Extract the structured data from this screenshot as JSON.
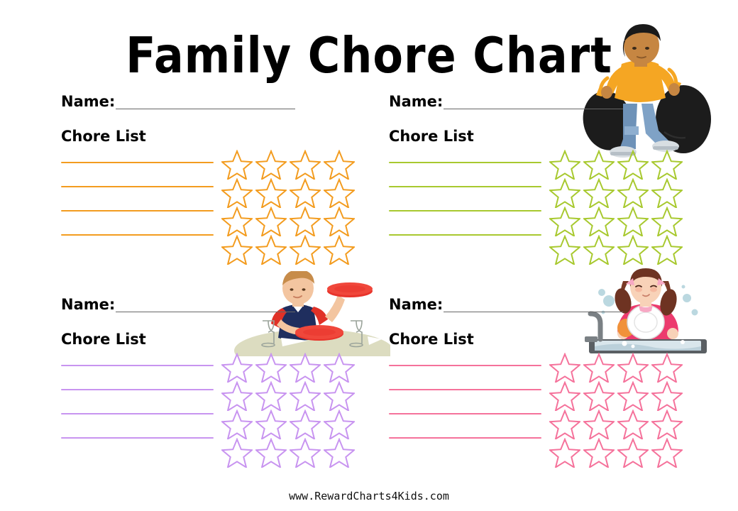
{
  "title": "Family Chore Chart",
  "footer": "www.RewardCharts4Kids.com",
  "labels": {
    "name": "Name:",
    "chore_list": "Chore List"
  },
  "colors": {
    "orange": "#F39C1F",
    "green": "#A8C92F",
    "purple": "#C894F0",
    "pink": "#F5729B",
    "name_rule": "#666666",
    "text": "#000000",
    "background": "#FFFFFF"
  },
  "quadrants": [
    {
      "id": "top-left",
      "name_label": "Name:",
      "name_value": "",
      "chore_list_label": "Chore List",
      "accent": "#F39C1F",
      "line_count": 4,
      "star_rows": 4,
      "star_cols": 4,
      "star_total": 16,
      "chores": [
        "",
        "",
        "",
        ""
      ]
    },
    {
      "id": "top-right",
      "name_label": "Name:",
      "name_value": "",
      "chore_list_label": "Chore List",
      "accent": "#A8C92F",
      "line_count": 4,
      "star_rows": 4,
      "star_cols": 4,
      "star_total": 16,
      "chores": [
        "",
        "",
        "",
        ""
      ]
    },
    {
      "id": "bottom-left",
      "name_label": "Name:",
      "name_value": "",
      "chore_list_label": "Chore List",
      "accent": "#C894F0",
      "line_count": 4,
      "star_rows": 4,
      "star_cols": 4,
      "star_total": 16,
      "chores": [
        "",
        "",
        "",
        ""
      ]
    },
    {
      "id": "bottom-right",
      "name_label": "Name:",
      "name_value": "",
      "chore_list_label": "Chore List",
      "accent": "#F5729B",
      "line_count": 4,
      "star_rows": 4,
      "star_cols": 4,
      "star_total": 16,
      "chores": [
        "",
        "",
        "",
        ""
      ]
    }
  ],
  "illustrations": [
    {
      "id": "boy-taking-out-trash",
      "description": "Boy in orange t-shirt and blue jeans carrying two black garbage bags",
      "colors": {
        "shirt": "#F5A623",
        "jeans": "#6E92B8",
        "hair": "#1A1A1A",
        "skin": "#C68642",
        "bag": "#1C1C1C",
        "bag_handle": "#F5A623",
        "shoe": "#D8DEE2"
      }
    },
    {
      "id": "boy-setting-table",
      "description": "Boy in navy vest with red sleeves placing red plates on a table with wine glasses and napkins",
      "colors": {
        "vest": "#1F2E5E",
        "sleeves": "#E03127",
        "hair": "#C78C4A",
        "skin": "#F3C5A0",
        "plate": "#E8342B",
        "table": "#DCDCC0",
        "glass": "#9AA39A",
        "napkin": "#FFFFFF"
      }
    },
    {
      "id": "girl-washing-dishes",
      "description": "Girl with brown pigtails and pink bows washing a white plate at a sink with bubbles",
      "colors": {
        "shirt": "#EC3B6E",
        "hair": "#6E3322",
        "skin": "#F8D2B8",
        "bow": "#F7A8C4",
        "sink": "#5A5F63",
        "plate": "#FFFFFF",
        "bubble": "#BBD8E0",
        "sponge": "#F0913A"
      }
    }
  ]
}
